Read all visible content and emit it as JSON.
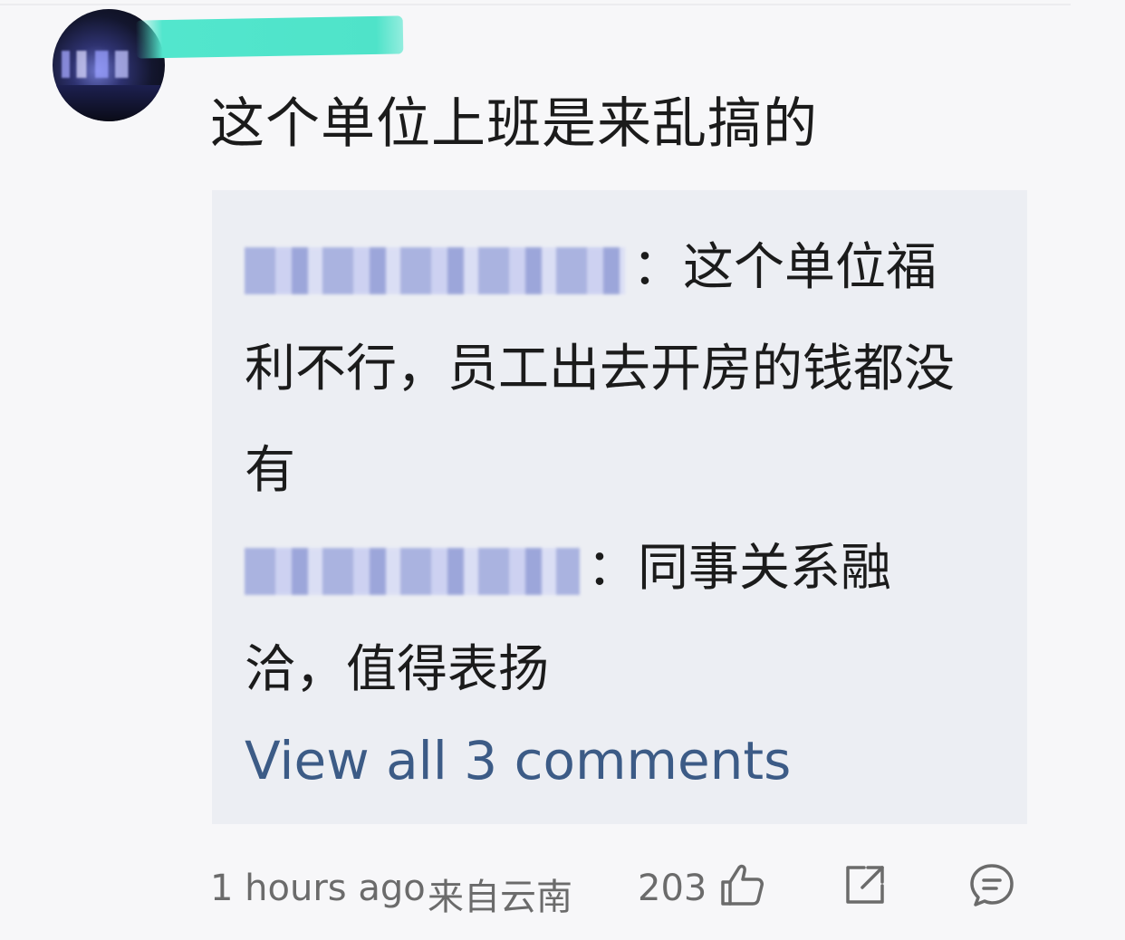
{
  "post": {
    "text": "这个单位上班是来乱搞的"
  },
  "replies": [
    {
      "text": "：这个单位福利不行，员工出去开房的钱都没有"
    },
    {
      "text": "：同事关系融洽，值得表扬"
    }
  ],
  "view_all_label": "View all 3 comments",
  "meta": {
    "time": "1 hours ago",
    "location": "来自云南",
    "likes": "203"
  },
  "icons": {
    "like": "thumbs-up-icon",
    "share": "share-icon",
    "comment": "comment-icon"
  },
  "colors": {
    "link": "#3c5b86",
    "meta": "#6b6b6b",
    "reply_box": "#eceef3"
  }
}
